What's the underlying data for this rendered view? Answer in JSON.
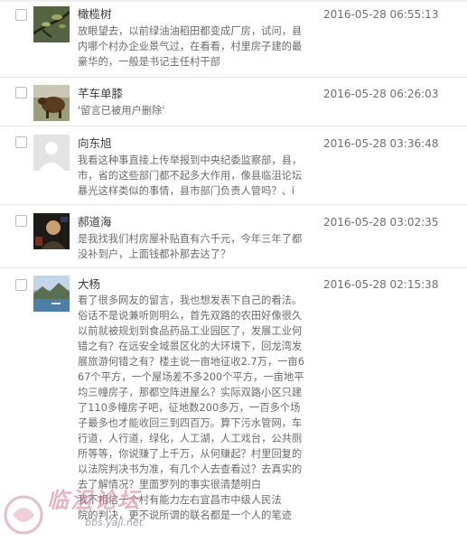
{
  "comments": [
    {
      "username": "橄榄树",
      "timestamp": "2016-05-28 06:55:13",
      "lines": [
        "放眼望去，以前绿油油稻田都变成厂房，试问，县",
        "内哪个村办企业景气过，在看看，村里房子建的最",
        "豪华的，一般是书记主任村干部"
      ]
    },
    {
      "username": "芊车单膝",
      "timestamp": "2016-05-28 06:26:03",
      "lines": [
        "'留言已被用户删除'"
      ]
    },
    {
      "username": "向东旭",
      "timestamp": "2016-05-28 03:36:48",
      "lines": [
        "我看这种事直接上传举报到中央纪委监察部，县，",
        "市，省的这些部门都不起多大作用，像县临沮论坛",
        "暴光这样类似的事情，县市部门负责人管吗？、i"
      ]
    },
    {
      "username": "郝道海",
      "timestamp": "2016-05-28 03:02:35",
      "lines": [
        "是我找我们村房屋补贴直有六千元，今年三年了都",
        "没补到户，上面钱都补那去达了？"
      ]
    },
    {
      "username": "大杨",
      "timestamp": "2016-05-28 02:15:38",
      "lines": [
        "看了很多网友的留言，我也想发表下自己的看法。",
        "俗话不是说兼听则明么，首先双路的农田好像很久",
        "以前就被规划到食品药品工业园区了，发展工业何",
        "错之有？在远安全域景区化的大环境下，回龙湾发",
        "展旅游何错之有？楼主说一亩地征收2.7万，一亩6",
        "67个平方，一个屋场差不多200个平方，一亩地平",
        "均三幢房子，那都空阵进屋么？实际双路小区只建",
        "了110多幢房子吧，征地数200多万，一百多个场",
        "子最多也才能收回三到四百万。算下污水管网，车",
        "行道，人行道，绿化，人工湖，人工戏台，公共厕",
        "所等等，你说赚了上千万，从何赚起？村里回复的",
        "以法院判决书为准，有几个人去查看过？去真实的",
        "去了解情况？里面罗列的事实很清楚明白",
        "我不相信一个村有能力左右宜昌市中级人民法",
        "院的判决，更不说所谓的联名都是一个人的笔迹"
      ]
    }
  ],
  "watermark": {
    "text": "临沮论坛",
    "url": "bbs.yaji.net"
  }
}
